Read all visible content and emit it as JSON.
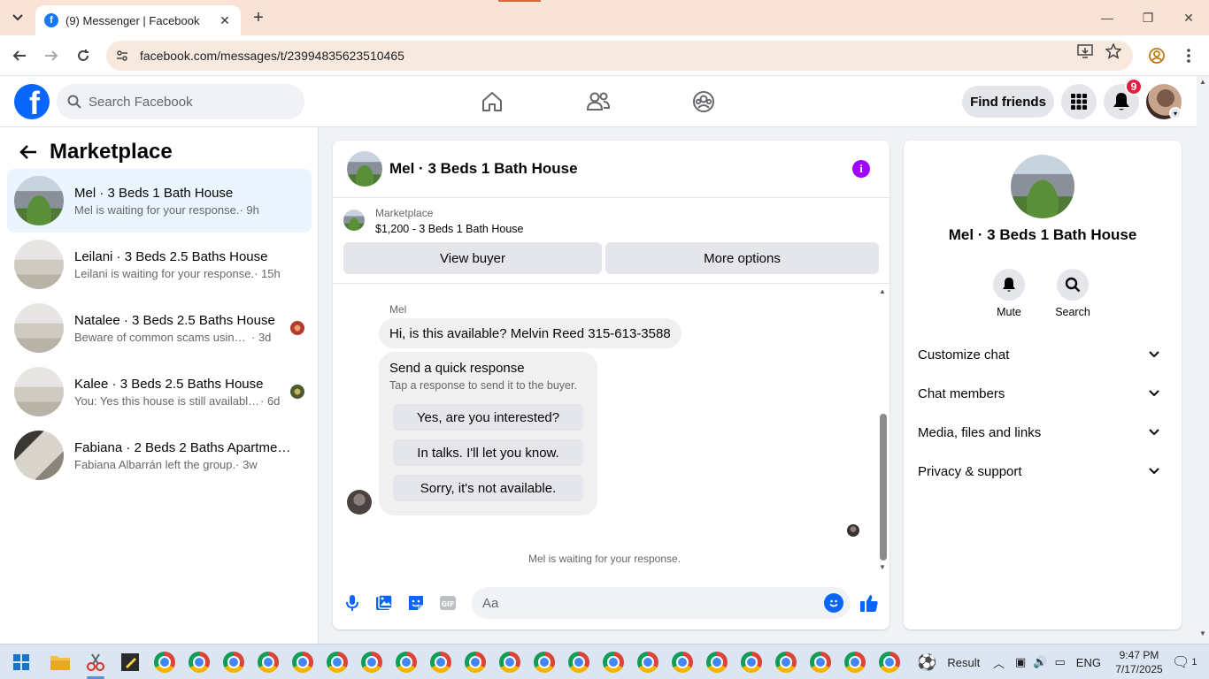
{
  "browser": {
    "tab_title": "(9) Messenger | Facebook",
    "url": "facebook.com/messages/t/23994835623510465"
  },
  "header": {
    "search_placeholder": "Search Facebook",
    "find_friends": "Find friends",
    "notification_count": "9"
  },
  "sidebar": {
    "title": "Marketplace",
    "conversations": [
      {
        "name": "Mel · 3 Beds 1 Bath House",
        "snippet": "Mel is waiting for your response.",
        "time": "· 9h"
      },
      {
        "name": "Leilani · 3 Beds 2.5 Baths House",
        "snippet": "Leilani is waiting for your response.",
        "time": "· 15h"
      },
      {
        "name": "Natalee · 3 Beds 2.5 Baths House",
        "snippet": "Beware of common scams using p...",
        "time": "· 3d"
      },
      {
        "name": "Kalee · 3 Beds 2.5 Baths House",
        "snippet": "You: Yes this house is still available ...",
        "time": "· 6d"
      },
      {
        "name": "Fabiana · 2 Beds 2 Baths Apartmen...",
        "snippet": "Fabiana Albarrán left the group.",
        "time": "· 3w"
      }
    ]
  },
  "chat": {
    "title": "Mel · 3 Beds 1 Bath House",
    "marketplace_label": "Marketplace",
    "listing": "$1,200 - 3 Beds 1 Bath House",
    "view_buyer": "View buyer",
    "more_options": "More options",
    "sender": "Mel",
    "message": "Hi, is this available? Melvin Reed 315-613-3588",
    "quick_title": "Send a quick response",
    "quick_sub": "Tap a response to send it to the buyer.",
    "quick_options": [
      "Yes, are you interested?",
      "In talks. I'll let you know.",
      "Sorry, it's not available."
    ],
    "waiting": "Mel is waiting for your response.",
    "composer_placeholder": "Aa"
  },
  "info": {
    "name": "Mel · 3 Beds 1 Bath House",
    "mute": "Mute",
    "search": "Search",
    "rows": [
      "Customize chat",
      "Chat members",
      "Media, files and links",
      "Privacy & support"
    ]
  },
  "taskbar": {
    "weather": "Result",
    "lang": "ENG",
    "time": "9:47 PM",
    "date": "7/17/2025",
    "notif": "1"
  },
  "colors": {
    "fb_blue": "#0866ff",
    "messenger_accent": "#a100ff",
    "active_row": "#ebf5ff"
  }
}
